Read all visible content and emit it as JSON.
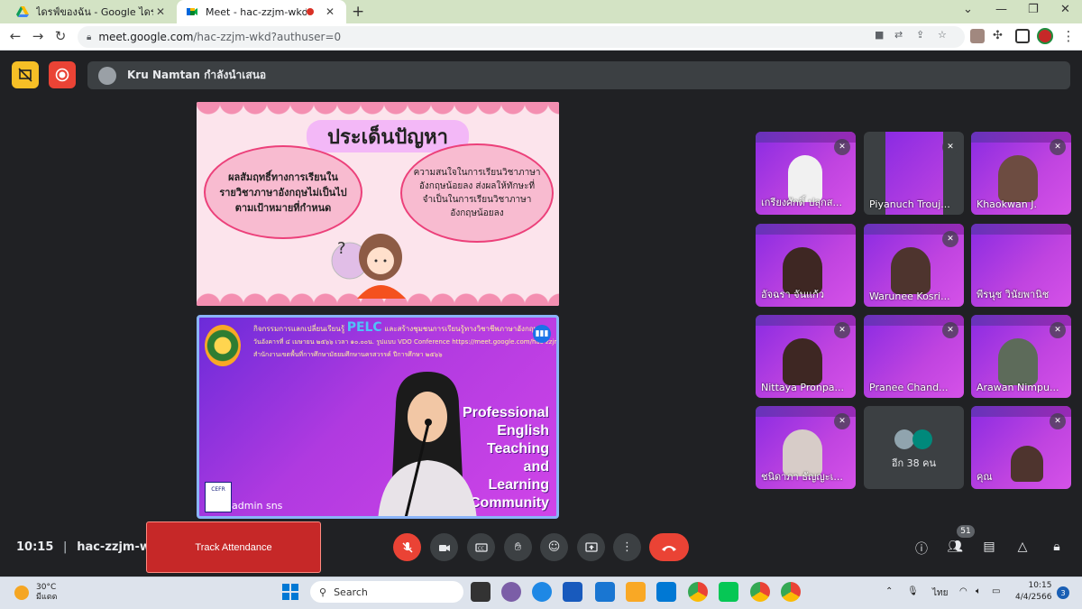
{
  "browser": {
    "tabs": [
      {
        "label": "ไดรฟ์ของฉัน - Google ไดรฟ์",
        "active": false
      },
      {
        "label": "Meet - hac-zzjm-wkd",
        "active": true
      }
    ],
    "url_host": "meet.google.com",
    "url_path": "/hac-zzjm-wkd?authuser=0"
  },
  "meet": {
    "presenter_text": "Kru Namtan กำลังนำเสนอ",
    "slide": {
      "title": "ประเด็นปัญหา",
      "left_bubble": "ผลสัมฤทธิ์ทางการเรียนในรายวิชาภาษาอังกฤษไม่เป็นไปตามเป้าหมายที่กำหนด",
      "right_bubble": "ความสนใจในการเรียนวิชาภาษาอังกฤษน้อยลง ส่งผลให้ทักษะที่จำเป็นในการเรียนวิชาภาษาอังกฤษน้อยลง"
    },
    "main_video": {
      "banner_line1": "กิจกรรมการแลกเปลี่ยนเรียนรู้",
      "banner_pelc": "PELC",
      "banner_line1b": "และสร้างชุมชนการเรียนรู้ทางวิชาชีพภาษาอังกฤษ",
      "banner_line2": "วันอังคารที่ ๔ เมษายน ๒๕๖๖ เวลา ๑๐.๐๐น. รูปแบบ VDO Conference https://meet.google.com/hac-zzjm-wkd",
      "banner_line3": "สำนักงานเขตพื้นที่การศึกษามัธยมศึกษานครสวรรค์ ปีการศึกษา ๒๕๖๖",
      "side_lines": [
        "Professional",
        "English",
        "Teaching",
        "and",
        "Learning",
        "Community"
      ],
      "cefr": "CEFR",
      "name": "admin sns"
    },
    "participants": [
      {
        "name": "เกรียงศักดิ์ ปลุกส...",
        "muted": true
      },
      {
        "name": "Piyanuch Trouj...",
        "muted": true
      },
      {
        "name": "Khaokwan J.",
        "muted": true
      },
      {
        "name": "อัจฉรา จันแก้ว",
        "muted": false
      },
      {
        "name": "Warunee Kosri...",
        "muted": true
      },
      {
        "name": "พีรนุช วินัยพานิช",
        "muted": false
      },
      {
        "name": "Nittaya Pronpa...",
        "muted": true
      },
      {
        "name": "Pranee Chand...",
        "muted": true
      },
      {
        "name": "Arawan Nimpu...",
        "muted": true
      },
      {
        "name": "ชนิดาภา ธัญญะเ...",
        "muted": true
      },
      {
        "name": "คุณ",
        "muted": true
      }
    ],
    "more_participants": "อีก 38 คน",
    "meeting_time": "10:15",
    "meeting_code": "hac-zzjm-wkd",
    "track_attendance": "Track Attendance",
    "people_count": "51"
  },
  "taskbar": {
    "temperature": "30°C",
    "weather": "มีแดด",
    "search_placeholder": "Search",
    "language": "ไทย",
    "time": "10:15",
    "date": "4/4/2566",
    "notifications": "3"
  },
  "colors": {
    "meet_bg": "#202124",
    "tab_strip": "#d3e3c4",
    "accent_blue": "#8ab4f8",
    "hangup_red": "#ea4335",
    "track_red": "#c62828"
  }
}
